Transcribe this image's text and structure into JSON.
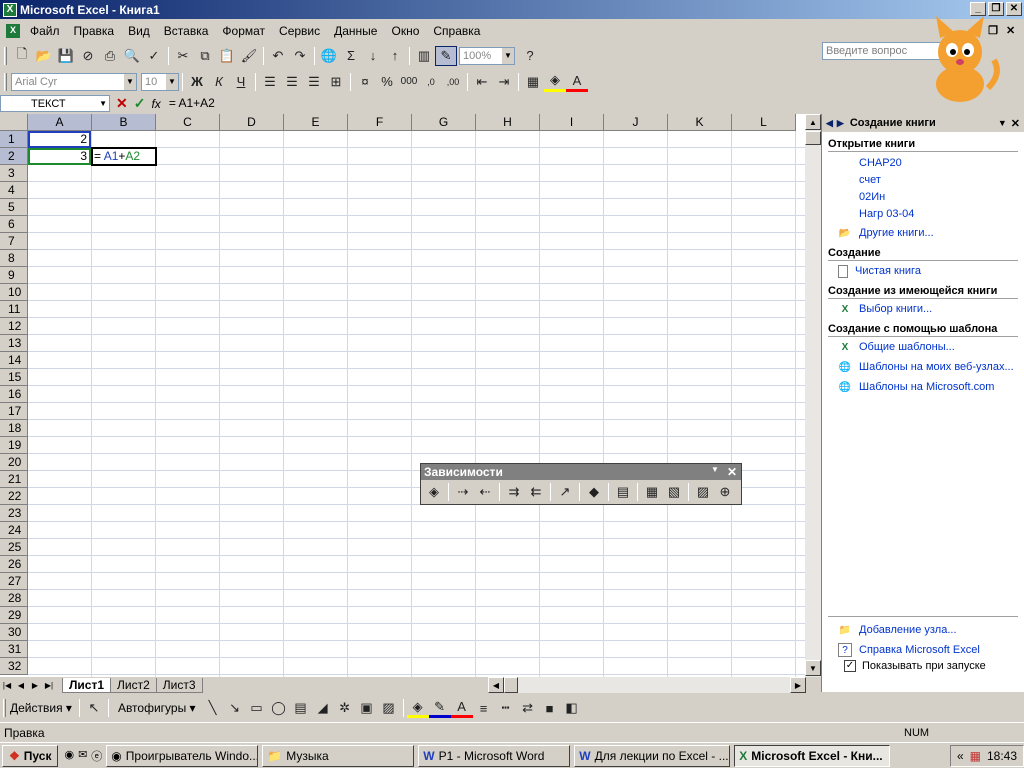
{
  "window": {
    "title": "Microsoft Excel - Книга1"
  },
  "menu": {
    "items": [
      "Файл",
      "Правка",
      "Вид",
      "Вставка",
      "Формат",
      "Сервис",
      "Данные",
      "Окно",
      "Справка"
    ],
    "help_placeholder": "Введите вопрос"
  },
  "toolbar": {
    "zoom": "100%",
    "font": "Arial Cyr",
    "font_size": "10"
  },
  "formula": {
    "namebox": "ТЕКСТ",
    "fx": "fx",
    "content": "= A1+A2"
  },
  "grid": {
    "columns": [
      "A",
      "B",
      "C",
      "D",
      "E",
      "F",
      "G",
      "H",
      "I",
      "J",
      "K",
      "L"
    ],
    "rows": [
      "1",
      "2",
      "3",
      "4",
      "5",
      "6",
      "7",
      "8",
      "9",
      "10",
      "11",
      "12",
      "13",
      "14",
      "15",
      "16",
      "17",
      "18",
      "19",
      "20",
      "21",
      "22",
      "23",
      "24",
      "25",
      "26",
      "27",
      "28",
      "29",
      "30",
      "31",
      "32"
    ],
    "cells": {
      "A1": "2",
      "A2": "3",
      "B2_eq": "= ",
      "B2_a1": "A1",
      "B2_plus": "+",
      "B2_a2": "A2"
    }
  },
  "sheets": {
    "tabs": [
      "Лист1",
      "Лист2",
      "Лист3"
    ],
    "active": "Лист1"
  },
  "taskpane": {
    "title": "Создание книги",
    "open_section": "Открытие книги",
    "recent": [
      "CHAP20",
      "счет",
      "02Ин",
      "Нагр 03-04"
    ],
    "other_books": "Другие книги...",
    "create_section": "Создание",
    "blank": "Чистая книга",
    "from_existing_section": "Создание из имеющейся книги",
    "choose_book": "Выбор книги...",
    "template_section": "Создание с помощью шаблона",
    "templates": [
      "Общие шаблоны...",
      "Шаблоны на моих веб-узлах...",
      "Шаблоны на Microsoft.com"
    ],
    "add_node": "Добавление узла...",
    "help": "Справка Microsoft Excel",
    "show_on_start": "Показывать при запуске"
  },
  "dependencies": {
    "title": "Зависимости"
  },
  "drawing": {
    "actions": "Действия",
    "autoshapes": "Автофигуры"
  },
  "status": {
    "text": "Правка",
    "num": "NUM"
  },
  "taskbar": {
    "start": "Пуск",
    "buttons": [
      "Проигрыватель Windo...",
      "Музыка",
      "P1 - Microsoft Word",
      "Для лекции по Excel - ...",
      "Microsoft Excel - Кни..."
    ],
    "time": "18:43"
  },
  "colors": {
    "title_start": "#0a246a",
    "title_end": "#a6caf0",
    "formula_a1": "#1f3fbf",
    "formula_a2": "#1e8a2e",
    "link": "#0033cc"
  }
}
